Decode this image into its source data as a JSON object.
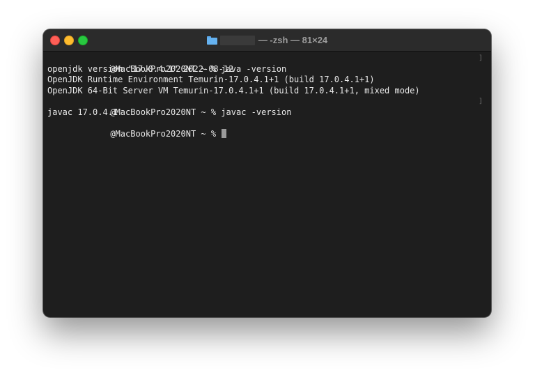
{
  "window": {
    "title": "— -zsh — 81×24"
  },
  "terminal": {
    "prompt": "@MacBookPro2020NT ~ % ",
    "lines": [
      {
        "type": "prompt",
        "command": "java -version"
      },
      {
        "type": "output",
        "text": "openjdk version \"17.0.4.1\" 2022-08-12"
      },
      {
        "type": "output",
        "text": "OpenJDK Runtime Environment Temurin-17.0.4.1+1 (build 17.0.4.1+1)"
      },
      {
        "type": "output",
        "text": "OpenJDK 64-Bit Server VM Temurin-17.0.4.1+1 (build 17.0.4.1+1, mixed mode)"
      },
      {
        "type": "prompt",
        "command": "javac -version"
      },
      {
        "type": "output",
        "text": "javac 17.0.4.1"
      },
      {
        "type": "prompt",
        "command": ""
      }
    ],
    "bracket": "]"
  }
}
